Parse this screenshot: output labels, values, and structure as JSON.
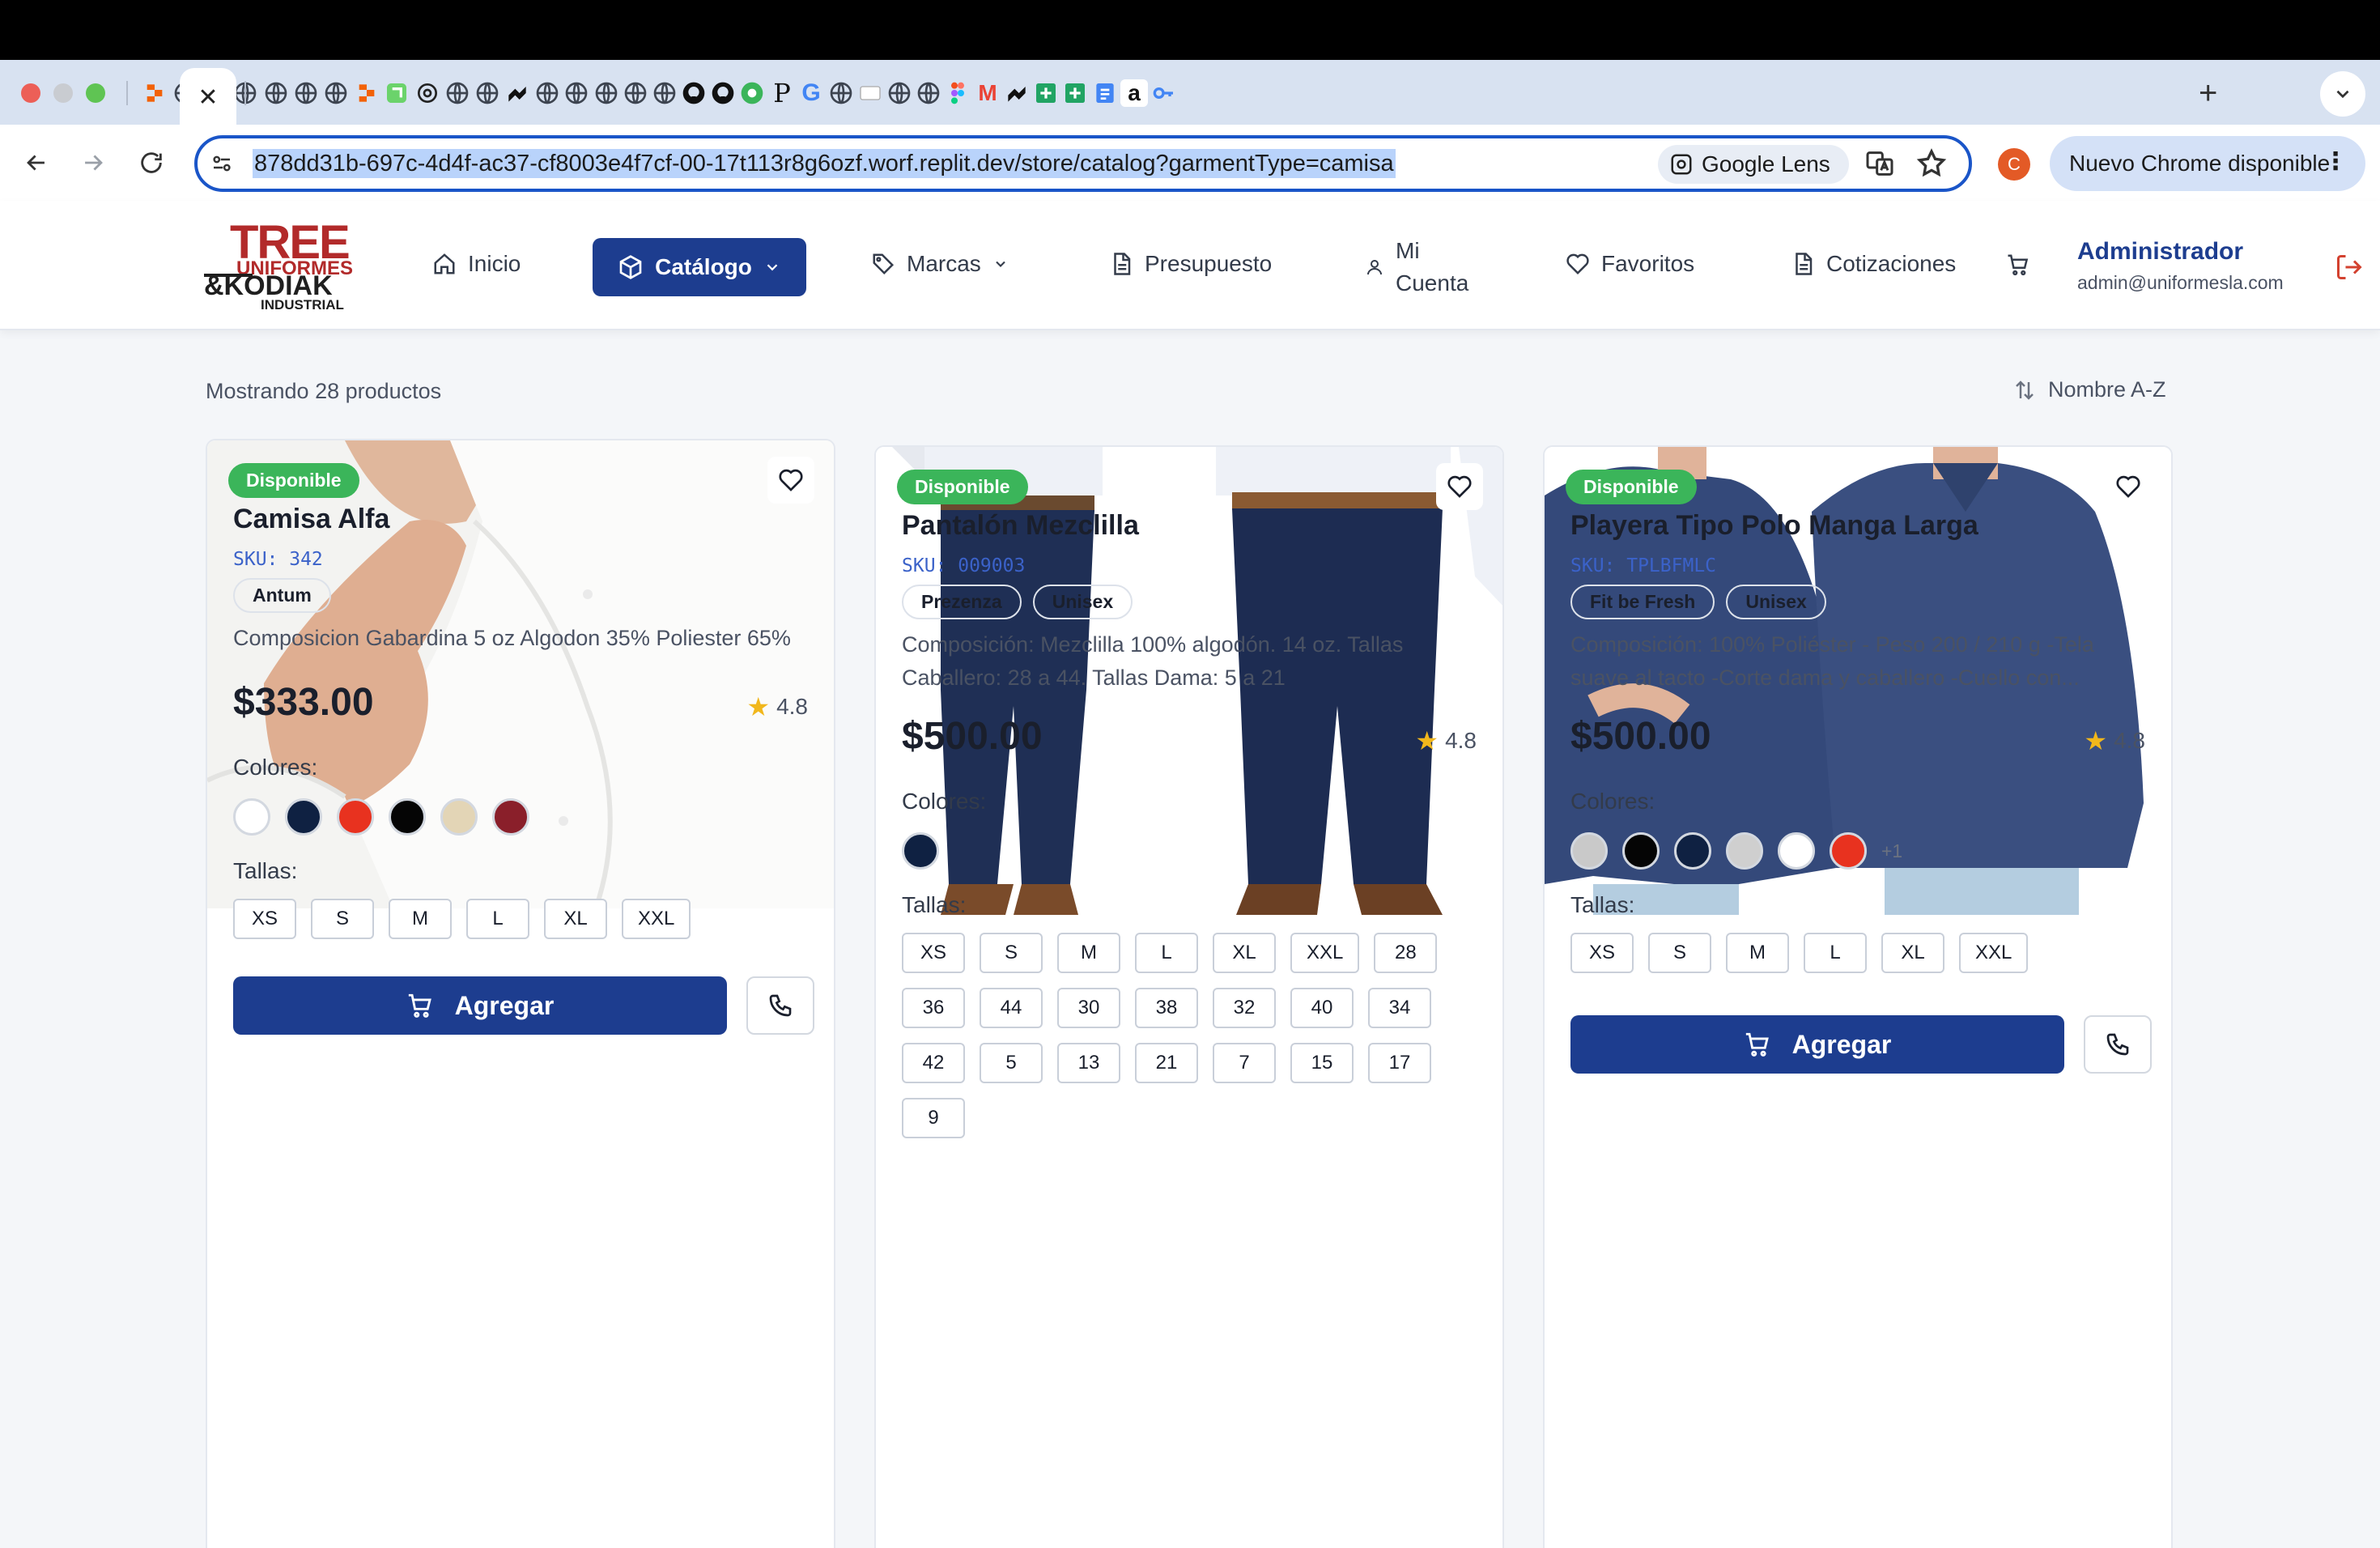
{
  "browser": {
    "active_tab_close": "✕",
    "new_tab": "+",
    "url": "878dd31b-697c-4d4f-ac37-cf8003e4f7cf-00-17t113r8g6ozf.worf.replit.dev/store/catalog?garmentType=camisa",
    "lens_label": "Google Lens",
    "profile_initial": "C",
    "update_label": "Nuevo Chrome disponible",
    "update_menu": "⋮",
    "tab_glyphs": [
      "P",
      "G",
      "M",
      "a"
    ]
  },
  "logo": {
    "line1": "TREE",
    "line2": "UNIFORMES",
    "line3": "&KODIAK",
    "line4": "INDUSTRIAL"
  },
  "nav": {
    "home": "Inicio",
    "catalog": "Catálogo",
    "brands": "Marcas",
    "budget": "Presupuesto",
    "account_line1": "Mi",
    "account_line2": "Cuenta",
    "favorites": "Favoritos",
    "quotes": "Cotizaciones",
    "user_name": "Administrador",
    "user_email": "admin@uniformesla.com"
  },
  "catalog": {
    "count_label": "Mostrando 28 productos",
    "sort_label": "Nombre A-Z",
    "colors_label": "Colores:",
    "sizes_label": "Tallas:",
    "add_label": "Agregar"
  },
  "products": [
    {
      "badge": "Disponible",
      "name": "Camisa Alfa",
      "sku": "SKU: 342",
      "tags": [
        "Antum"
      ],
      "description": "Composicion Gabardina 5 oz Algodon 35% Poliester 65%",
      "price": "$333.00",
      "rating": "4.8",
      "colors": [
        "#ffffff",
        "#0f2142",
        "#e8321f",
        "#050505",
        "#e3d5b6",
        "#8a1f2a"
      ],
      "more_colors": "",
      "sizes": [
        "XS",
        "S",
        "M",
        "L",
        "XL",
        "XXL"
      ]
    },
    {
      "badge": "Disponible",
      "name": "Pantalón Mezclilla",
      "sku": "SKU: 009003",
      "tags": [
        "Prezenza",
        "Unisex"
      ],
      "description": "Composición: Mezclilla 100% algodón. 14 oz. Tallas Caballero: 28 a 44. Tallas Dama: 5 a 21",
      "price": "$500.00",
      "rating": "4.8",
      "colors": [
        "#0f2142"
      ],
      "more_colors": "",
      "sizes": [
        "XS",
        "S",
        "M",
        "L",
        "XL",
        "XXL",
        "28",
        "36",
        "44",
        "30",
        "38",
        "32",
        "40",
        "34",
        "42",
        "5",
        "13",
        "21",
        "7",
        "15",
        "17",
        "9"
      ]
    },
    {
      "badge": "Disponible",
      "name": "Playera Tipo Polo Manga Larga",
      "sku": "SKU: TPLBFMLC",
      "tags": [
        "Fit be Fresh",
        "Unisex"
      ],
      "description": "Composición: 100% Poliéster - Peso 200 / 210 g -Tela suave al tacto -Corte dama y caballero -Cuello con...",
      "price": "$500.00",
      "rating": "4.8",
      "colors": [
        "#c9c9c9",
        "#050505",
        "#0f2142",
        "#cfcfcf",
        "#ffffff",
        "#e8321f"
      ],
      "more_colors": "+1",
      "sizes": [
        "XS",
        "S",
        "M",
        "L",
        "XL",
        "XXL"
      ]
    }
  ]
}
